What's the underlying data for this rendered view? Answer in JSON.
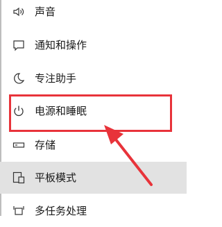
{
  "nav": {
    "items": [
      {
        "label": "声音",
        "icon": "speaker-icon"
      },
      {
        "label": "通知和操作",
        "icon": "message-icon"
      },
      {
        "label": "专注助手",
        "icon": "moon-icon"
      },
      {
        "label": "电源和睡眠",
        "icon": "power-icon"
      },
      {
        "label": "存储",
        "icon": "storage-icon"
      },
      {
        "label": "平板模式",
        "icon": "tablet-mode-icon"
      },
      {
        "label": "多任务处理",
        "icon": "multitasking-icon"
      }
    ],
    "selected": "平板模式"
  },
  "annotation": {
    "color": "#e8333a",
    "target": "电源和睡眠"
  }
}
